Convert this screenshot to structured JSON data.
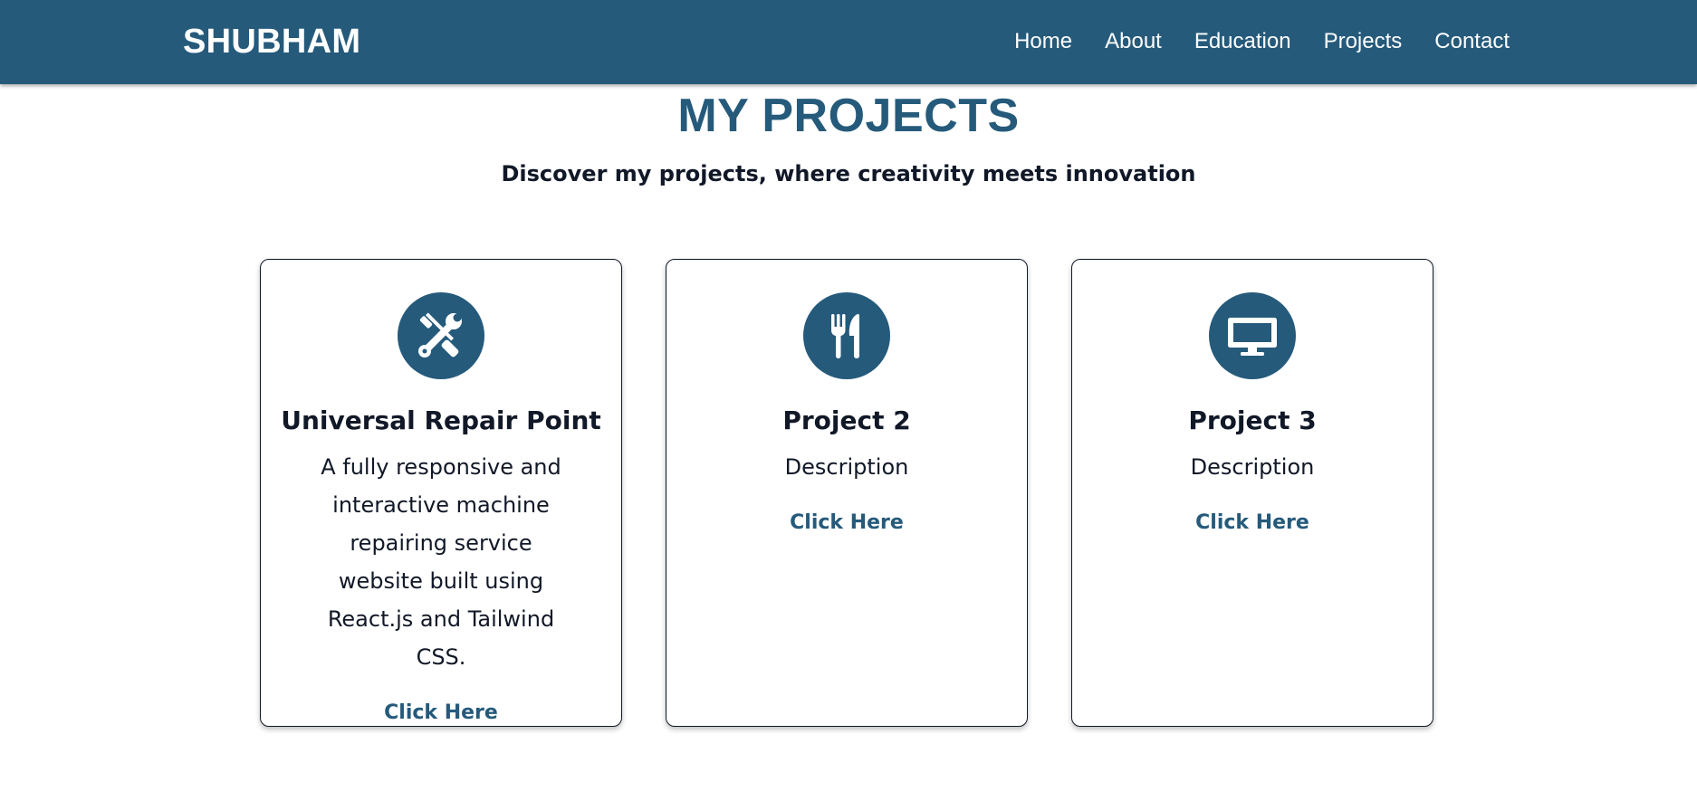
{
  "nav": {
    "brand": "SHUBHAM",
    "links": [
      "Home",
      "About",
      "Education",
      "Projects",
      "Contact"
    ]
  },
  "header": {
    "title": "MY PROJECTS",
    "subtitle": "Discover my projects, where creativity meets innovation"
  },
  "projects": [
    {
      "icon": "tools-icon",
      "title": "Universal Repair Point",
      "description": "A fully responsive and interactive machine repairing service website built using React.js and Tailwind CSS.",
      "link": "Click Here"
    },
    {
      "icon": "utensils-icon",
      "title": "Project 2",
      "description": "Description",
      "link": "Click Here"
    },
    {
      "icon": "desktop-icon",
      "title": "Project 3",
      "description": "Description",
      "link": "Click Here"
    }
  ],
  "colors": {
    "primary": "#255a7b",
    "text": "#111827",
    "background": "#ffffff"
  }
}
